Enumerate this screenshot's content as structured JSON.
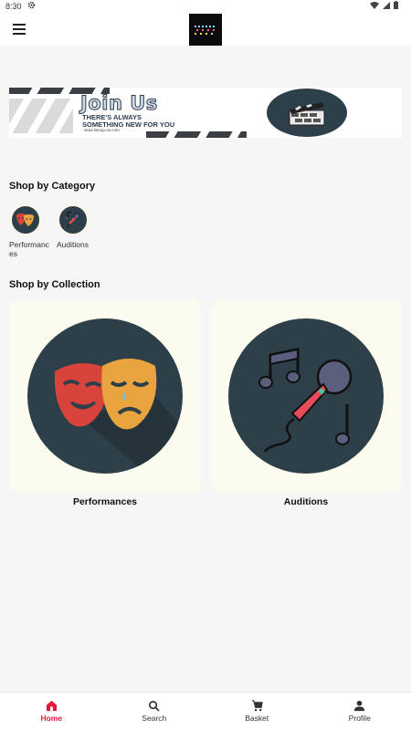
{
  "status_bar": {
    "time": "8:30"
  },
  "banner": {
    "title": "Join Us",
    "line1": "THERE'S ALWAYS",
    "line2": "SOMETHING NEW FOR YOU",
    "url": "www.lineup-sa.com"
  },
  "sections": {
    "category_title": "Shop by Category",
    "collection_title": "Shop by Collection"
  },
  "categories": [
    {
      "label": "Performances",
      "icon": "theatre-masks-icon"
    },
    {
      "label": "Auditions",
      "icon": "microphone-music-icon"
    }
  ],
  "collections": [
    {
      "label": "Performances",
      "icon": "theatre-masks-icon"
    },
    {
      "label": "Auditions",
      "icon": "microphone-music-icon"
    }
  ],
  "bottom_nav": [
    {
      "label": "Home",
      "icon": "home-icon",
      "active": true
    },
    {
      "label": "Search",
      "icon": "search-icon",
      "active": false
    },
    {
      "label": "Basket",
      "icon": "cart-icon",
      "active": false
    },
    {
      "label": "Profile",
      "icon": "person-icon",
      "active": false
    }
  ],
  "colors": {
    "accent": "#e8163f",
    "icon_circle": "#2d3f48",
    "card_bg": "#fcfbef",
    "page_bg": "#f6f6f6"
  }
}
